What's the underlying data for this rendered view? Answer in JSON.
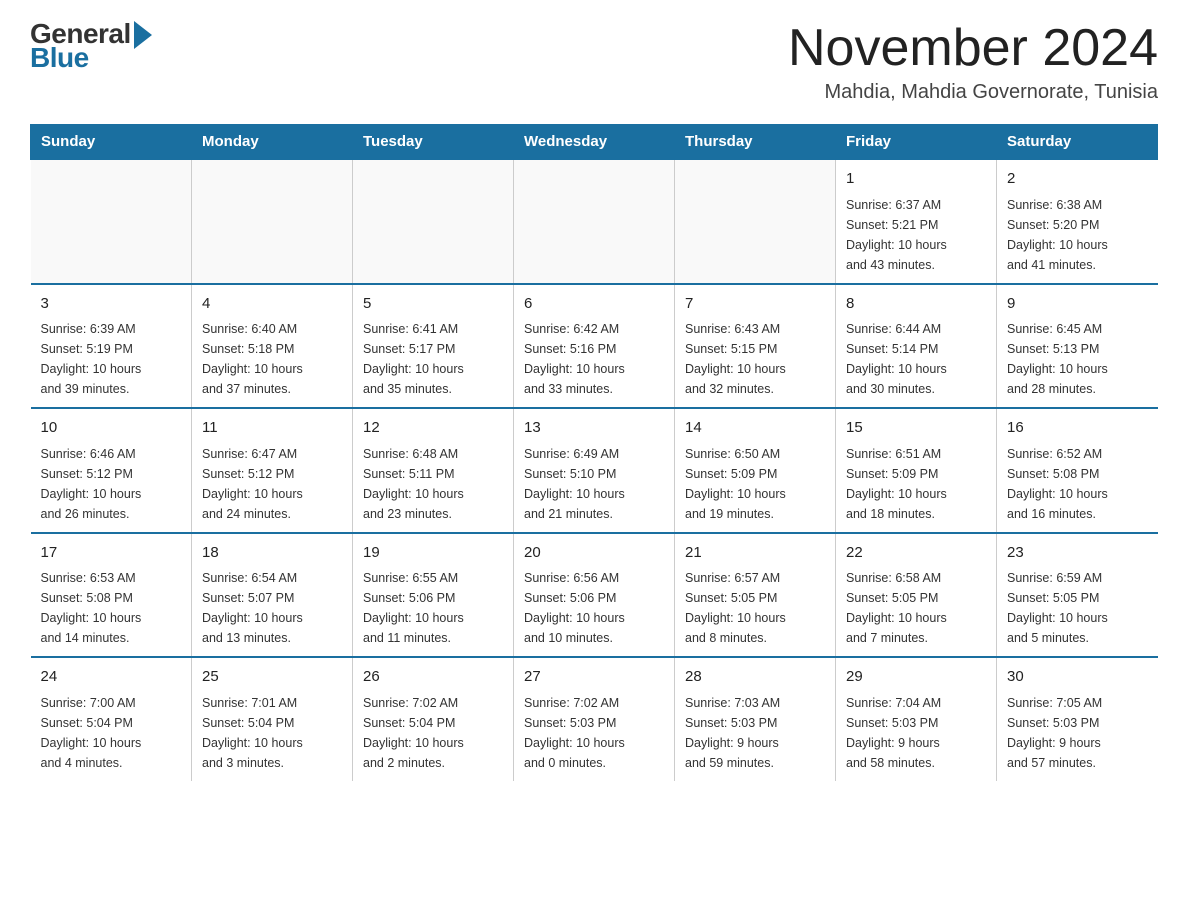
{
  "header": {
    "logo_general": "General",
    "logo_blue": "Blue",
    "month_title": "November 2024",
    "location": "Mahdia, Mahdia Governorate, Tunisia"
  },
  "weekdays": [
    "Sunday",
    "Monday",
    "Tuesday",
    "Wednesday",
    "Thursday",
    "Friday",
    "Saturday"
  ],
  "weeks": [
    [
      {
        "day": "",
        "info": ""
      },
      {
        "day": "",
        "info": ""
      },
      {
        "day": "",
        "info": ""
      },
      {
        "day": "",
        "info": ""
      },
      {
        "day": "",
        "info": ""
      },
      {
        "day": "1",
        "info": "Sunrise: 6:37 AM\nSunset: 5:21 PM\nDaylight: 10 hours\nand 43 minutes."
      },
      {
        "day": "2",
        "info": "Sunrise: 6:38 AM\nSunset: 5:20 PM\nDaylight: 10 hours\nand 41 minutes."
      }
    ],
    [
      {
        "day": "3",
        "info": "Sunrise: 6:39 AM\nSunset: 5:19 PM\nDaylight: 10 hours\nand 39 minutes."
      },
      {
        "day": "4",
        "info": "Sunrise: 6:40 AM\nSunset: 5:18 PM\nDaylight: 10 hours\nand 37 minutes."
      },
      {
        "day": "5",
        "info": "Sunrise: 6:41 AM\nSunset: 5:17 PM\nDaylight: 10 hours\nand 35 minutes."
      },
      {
        "day": "6",
        "info": "Sunrise: 6:42 AM\nSunset: 5:16 PM\nDaylight: 10 hours\nand 33 minutes."
      },
      {
        "day": "7",
        "info": "Sunrise: 6:43 AM\nSunset: 5:15 PM\nDaylight: 10 hours\nand 32 minutes."
      },
      {
        "day": "8",
        "info": "Sunrise: 6:44 AM\nSunset: 5:14 PM\nDaylight: 10 hours\nand 30 minutes."
      },
      {
        "day": "9",
        "info": "Sunrise: 6:45 AM\nSunset: 5:13 PM\nDaylight: 10 hours\nand 28 minutes."
      }
    ],
    [
      {
        "day": "10",
        "info": "Sunrise: 6:46 AM\nSunset: 5:12 PM\nDaylight: 10 hours\nand 26 minutes."
      },
      {
        "day": "11",
        "info": "Sunrise: 6:47 AM\nSunset: 5:12 PM\nDaylight: 10 hours\nand 24 minutes."
      },
      {
        "day": "12",
        "info": "Sunrise: 6:48 AM\nSunset: 5:11 PM\nDaylight: 10 hours\nand 23 minutes."
      },
      {
        "day": "13",
        "info": "Sunrise: 6:49 AM\nSunset: 5:10 PM\nDaylight: 10 hours\nand 21 minutes."
      },
      {
        "day": "14",
        "info": "Sunrise: 6:50 AM\nSunset: 5:09 PM\nDaylight: 10 hours\nand 19 minutes."
      },
      {
        "day": "15",
        "info": "Sunrise: 6:51 AM\nSunset: 5:09 PM\nDaylight: 10 hours\nand 18 minutes."
      },
      {
        "day": "16",
        "info": "Sunrise: 6:52 AM\nSunset: 5:08 PM\nDaylight: 10 hours\nand 16 minutes."
      }
    ],
    [
      {
        "day": "17",
        "info": "Sunrise: 6:53 AM\nSunset: 5:08 PM\nDaylight: 10 hours\nand 14 minutes."
      },
      {
        "day": "18",
        "info": "Sunrise: 6:54 AM\nSunset: 5:07 PM\nDaylight: 10 hours\nand 13 minutes."
      },
      {
        "day": "19",
        "info": "Sunrise: 6:55 AM\nSunset: 5:06 PM\nDaylight: 10 hours\nand 11 minutes."
      },
      {
        "day": "20",
        "info": "Sunrise: 6:56 AM\nSunset: 5:06 PM\nDaylight: 10 hours\nand 10 minutes."
      },
      {
        "day": "21",
        "info": "Sunrise: 6:57 AM\nSunset: 5:05 PM\nDaylight: 10 hours\nand 8 minutes."
      },
      {
        "day": "22",
        "info": "Sunrise: 6:58 AM\nSunset: 5:05 PM\nDaylight: 10 hours\nand 7 minutes."
      },
      {
        "day": "23",
        "info": "Sunrise: 6:59 AM\nSunset: 5:05 PM\nDaylight: 10 hours\nand 5 minutes."
      }
    ],
    [
      {
        "day": "24",
        "info": "Sunrise: 7:00 AM\nSunset: 5:04 PM\nDaylight: 10 hours\nand 4 minutes."
      },
      {
        "day": "25",
        "info": "Sunrise: 7:01 AM\nSunset: 5:04 PM\nDaylight: 10 hours\nand 3 minutes."
      },
      {
        "day": "26",
        "info": "Sunrise: 7:02 AM\nSunset: 5:04 PM\nDaylight: 10 hours\nand 2 minutes."
      },
      {
        "day": "27",
        "info": "Sunrise: 7:02 AM\nSunset: 5:03 PM\nDaylight: 10 hours\nand 0 minutes."
      },
      {
        "day": "28",
        "info": "Sunrise: 7:03 AM\nSunset: 5:03 PM\nDaylight: 9 hours\nand 59 minutes."
      },
      {
        "day": "29",
        "info": "Sunrise: 7:04 AM\nSunset: 5:03 PM\nDaylight: 9 hours\nand 58 minutes."
      },
      {
        "day": "30",
        "info": "Sunrise: 7:05 AM\nSunset: 5:03 PM\nDaylight: 9 hours\nand 57 minutes."
      }
    ]
  ],
  "accent_color": "#1a6fa0"
}
